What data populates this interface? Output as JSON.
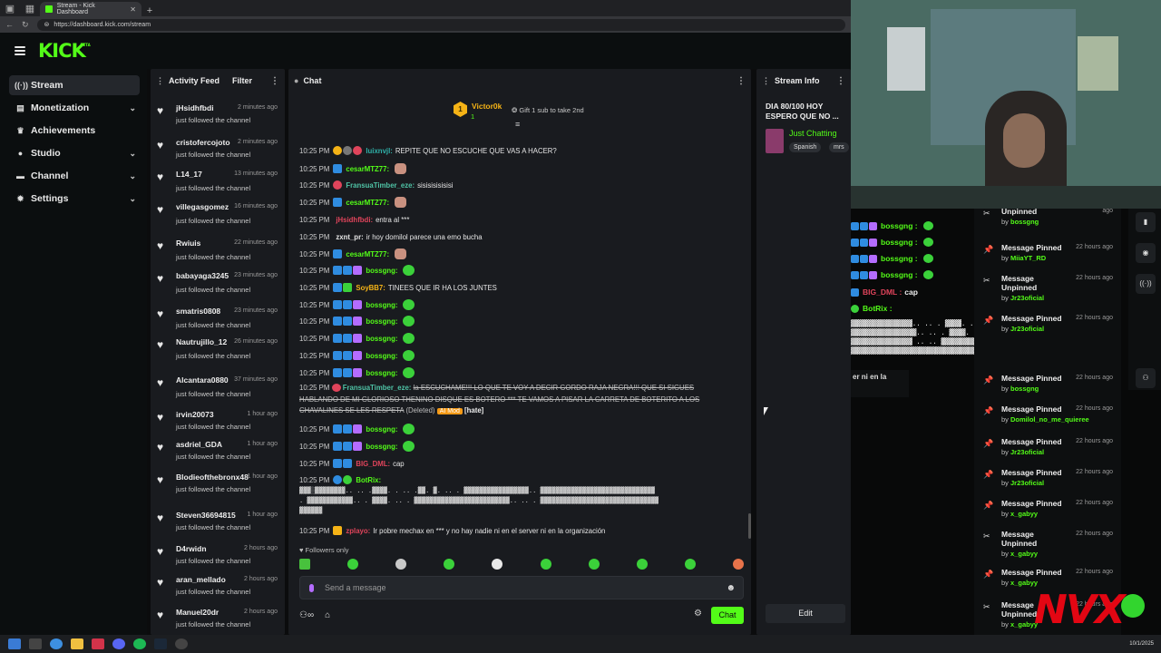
{
  "browser": {
    "tab_title": "Stream - Kick Dashboard",
    "url": "https://dashboard.kick.com/stream"
  },
  "header": {
    "logo": "KICK",
    "logo_badge": "BETA"
  },
  "sidebar": {
    "items": [
      {
        "label": "Stream",
        "icon": "stream-icon",
        "active": true,
        "expandable": false
      },
      {
        "label": "Monetization",
        "icon": "dollar-icon",
        "active": false,
        "expandable": true
      },
      {
        "label": "Achievements",
        "icon": "trophy-icon",
        "active": false,
        "expandable": false
      },
      {
        "label": "Studio",
        "icon": "studio-icon",
        "active": false,
        "expandable": true
      },
      {
        "label": "Channel",
        "icon": "channel-icon",
        "active": false,
        "expandable": true
      },
      {
        "label": "Settings",
        "icon": "gear-icon",
        "active": false,
        "expandable": true
      }
    ]
  },
  "activity": {
    "title": "Activity Feed",
    "filter_label": "Filter",
    "items": [
      {
        "user": "jHsidhfbdi",
        "text": "just followed the channel",
        "time": "2 minutes ago"
      },
      {
        "user": "cristofercojoto",
        "text": "just followed the channel",
        "time": "2 minutes ago"
      },
      {
        "user": "L14_17",
        "text": "just followed the channel",
        "time": "13 minutes ago"
      },
      {
        "user": "villegasgomez",
        "text": "just followed the channel",
        "time": "16 minutes ago"
      },
      {
        "user": "Rwiuis",
        "text": "just followed the channel",
        "time": "22 minutes ago"
      },
      {
        "user": "babayaga3245",
        "text": "just followed the channel",
        "time": "23 minutes ago"
      },
      {
        "user": "smatris0808",
        "text": "just followed the channel",
        "time": "23 minutes ago"
      },
      {
        "user": "Nautrujillo_12",
        "text": "just followed the channel",
        "time": "26 minutes ago"
      },
      {
        "user": "Alcantara0880",
        "text": "just followed the channel",
        "time": "37 minutes ago"
      },
      {
        "user": "irvin20073",
        "text": "just followed the channel",
        "time": "1 hour ago"
      },
      {
        "user": "asdriel_GDA",
        "text": "just followed the channel",
        "time": "1 hour ago"
      },
      {
        "user": "Blodieofthebronx48",
        "text": "just followed the channel",
        "time": "1 hour ago"
      },
      {
        "user": "Steven36694815",
        "text": "just followed the channel",
        "time": "1 hour ago"
      },
      {
        "user": "D4rwidn",
        "text": "just followed the channel",
        "time": "2 hours ago"
      },
      {
        "user": "aran_mellado",
        "text": "just followed the channel",
        "time": "2 hours ago"
      },
      {
        "user": "Manuel20dr",
        "text": "just followed the channel",
        "time": "2 hours ago"
      }
    ]
  },
  "chat": {
    "title": "Chat",
    "pinned_user": "Victor0k",
    "pinned_rank": "1",
    "pinned_count": "1",
    "gift_text": "Gift 1 sub to take 2nd",
    "messages": [
      {
        "time": "10:25 PM",
        "user": "luixnvjl:",
        "color": "#2fb0a8",
        "text": "REPITE QUE NO ESCUCHE QUE VAS A HACER?",
        "emote": ""
      },
      {
        "time": "10:25 PM",
        "user": "cesarMTZ77:",
        "color": "#53fc18",
        "text": "",
        "emote": "face"
      },
      {
        "time": "10:25 PM",
        "user": "FransuaTimber_eze:",
        "color": "#4fc3a6",
        "text": "sisisisisisisi",
        "emote": ""
      },
      {
        "time": "10:25 PM",
        "user": "cesarMTZ77:",
        "color": "#53fc18",
        "text": "",
        "emote": "face"
      },
      {
        "time": "10:25 PM",
        "user": "jHsidhfbdi:",
        "color": "#e0445b",
        "text": "entra al ***",
        "emote": ""
      },
      {
        "time": "10:25 PM",
        "user": "zxnt_pr:",
        "color": "#e6e6e6",
        "text": "ir hoy domilol parece una emo bucha",
        "emote": ""
      },
      {
        "time": "10:25 PM",
        "user": "cesarMTZ77:",
        "color": "#53fc18",
        "text": "",
        "emote": "face"
      },
      {
        "time": "10:25 PM",
        "user": "bossgng:",
        "color": "#53fc18",
        "text": "",
        "emote": "green"
      },
      {
        "time": "10:25 PM",
        "user": "SoyBB7:",
        "color": "#f5b316",
        "text": "TINEES QUE IR HA LOS JUNTES",
        "emote": ""
      },
      {
        "time": "10:25 PM",
        "user": "bossgng:",
        "color": "#53fc18",
        "text": "",
        "emote": "green"
      },
      {
        "time": "10:25 PM",
        "user": "bossgng:",
        "color": "#53fc18",
        "text": "",
        "emote": "green"
      },
      {
        "time": "10:25 PM",
        "user": "bossgng:",
        "color": "#53fc18",
        "text": "",
        "emote": "green"
      },
      {
        "time": "10:25 PM",
        "user": "bossgng:",
        "color": "#53fc18",
        "text": "",
        "emote": "green"
      },
      {
        "time": "10:25 PM",
        "user": "bossgng:",
        "color": "#53fc18",
        "text": "",
        "emote": "green"
      }
    ],
    "deleted_message": {
      "time": "10:25 PM",
      "user": "FransuaTimber_eze:",
      "text": "la ESCUCHAME!!! LO QUE TE VOY A DECIR GORDO RAJA NEGRA!!! QUE SI SIGUES HABLANDO DE MI GLORIOSO THENINO DISQUE ES BOTERO *** TE VAMOS A PISAR LA CARRETA DE BOTERITO A LOS CHAVALINES SE LES RESPETA",
      "deleted_label": "(Deleted)",
      "mod_label": "AI Mod",
      "reason": "[hate]"
    },
    "messages2": [
      {
        "time": "10:25 PM",
        "user": "bossgng:",
        "color": "#53fc18",
        "text": "",
        "emote": "green"
      },
      {
        "time": "10:25 PM",
        "user": "bossgng:",
        "color": "#53fc18",
        "text": "",
        "emote": "green"
      },
      {
        "time": "10:25 PM",
        "user": "BIG_DML:",
        "color": "#e0445b",
        "text": "cap",
        "emote": ""
      },
      {
        "time": "10:25 PM",
        "user": "BotRix:",
        "color": "#53fc18",
        "text": "",
        "emote": ""
      }
    ],
    "ascii_art": "▓▓▓░▓▓▓▓▓▓▓▓.. .. .▓▓▓▓. . .. .▓▓. ▓. .. . ▓▓▓▓▓▓▓▓▓▓▓▓▓▓▓▓▓.. ▓▓▓▓▓▓▓▓▓▓▓▓▓▓▓▓▓▓▓▓▓▓▓▓▓▓▓▓▓▓\n. ▓▓▓▓▓▓▓▓▓▓▓▓.. . ▓▓▓▓. .. . ▓▓▓▓▓▓▓▓▓▓▓▓▓▓▓▓▓▓▓▓▓▓▓▓▓.. .. . ▓▓▓▓▓▓▓▓▓▓▓▓▓▓▓▓▓▓▓▓▓▓▓▓▓▓▓▓▓▓▓\n▓▓▓▓▓▓",
    "last_message": {
      "time": "10:25 PM",
      "user": "zplayo:",
      "text": "Ir pobre mechax en *** y no hay nadie ni en el server ni en la organización"
    },
    "followers_only": "Followers only",
    "input_placeholder": "Send a message",
    "send_label": "Chat"
  },
  "stream_info": {
    "title_label": "Stream Info",
    "stream_title": "DIA 80/100 HOY ESPERO QUE NO ...",
    "category": "Just Chatting",
    "tags": [
      "Spanish",
      "mrs"
    ],
    "edit_label": "Edit"
  },
  "obs_overlay": {
    "chat_lines": [
      {
        "user": "bossgng :",
        "color": "#53fc18"
      },
      {
        "user": "bossgng :",
        "color": "#53fc18"
      },
      {
        "user": "bossgng :",
        "color": "#53fc18"
      },
      {
        "user": "bossgng :",
        "color": "#53fc18"
      }
    ],
    "big_dml": {
      "user": "BIG_DML :",
      "text": "cap"
    },
    "botrix": "BotRix :",
    "ascii": "▓▓▓▓▓▓▓▓▓▓▓▓▓▓▓.. .. . ▓▓▓▓. .. . ▓▓▓▓▓▓▓▓▓▓▓▓▓▓▓▓▓▓▓▓▓▓▓\n▓▓▓▓▓▓▓▓▓▓▓▓▓▓▓▓.. .. . ▓▓▓▓. . ▓▓▓▓▓▓▓▓▓▓▓▓▓▓▓▓▓▓▓▓▓▓▓▓▓\n▓▓▓▓▓▓▓▓▓▓▓▓▓▓▓ .. .. ▓▓▓▓▓▓▓▓▓▓▓▓▓▓▓▓▓▓▓▓▓▓▓▓▓▓▓▓▓▓▓▓▓▓▓\n▓▓▓▓▓▓▓▓▓▓▓▓▓▓▓▓▓▓▓▓▓▓▓▓▓▓▓▓▓▓▓▓▓▓▓▓▓▓▓▓▓▓▓▓▓▓▓▓▓▓▓▓▓▓▓",
    "trailing_text": "er ni en la",
    "pin_log": [
      {
        "title": "Unpinned",
        "time": "ago",
        "by": "bossgng",
        "icon": "unpin-icon"
      },
      {
        "title": "Message Pinned",
        "time": "22 hours ago",
        "by": "MiiaYT_RD",
        "icon": "pin-icon"
      },
      {
        "title": "Message Unpinned",
        "time": "22 hours ago",
        "by": "Jr23oficial",
        "icon": "unpin-icon"
      },
      {
        "title": "Message Pinned",
        "time": "22 hours ago",
        "by": "Jr23oficial",
        "icon": "pin-icon"
      },
      {
        "title": "Message Pinned",
        "time": "22 hours ago",
        "by": "bossgng",
        "icon": "pin-icon"
      },
      {
        "title": "Message Pinned",
        "time": "22 hours ago",
        "by": "Domilol_no_me_quieree",
        "icon": "pin-icon"
      },
      {
        "title": "Message Pinned",
        "time": "22 hours ago",
        "by": "Jr23oficial",
        "icon": "pin-icon"
      },
      {
        "title": "Message Pinned",
        "time": "22 hours ago",
        "by": "Jr23oficial",
        "icon": "pin-icon"
      },
      {
        "title": "Message Pinned",
        "time": "22 hours ago",
        "by": "x_gabyy",
        "icon": "pin-icon"
      },
      {
        "title": "Message Unpinned",
        "time": "22 hours ago",
        "by": "x_gabyy",
        "icon": "unpin-icon"
      },
      {
        "title": "Message Pinned",
        "time": "22 hours ago",
        "by": "x_gabyy",
        "icon": "pin-icon"
      },
      {
        "title": "Message Unpinned",
        "time": "22 hours ago",
        "by": "x_gabyy",
        "icon": "unpin-icon"
      }
    ],
    "watermark": "NVX"
  },
  "taskbar": {
    "time": "",
    "date": "10/1/2025"
  }
}
